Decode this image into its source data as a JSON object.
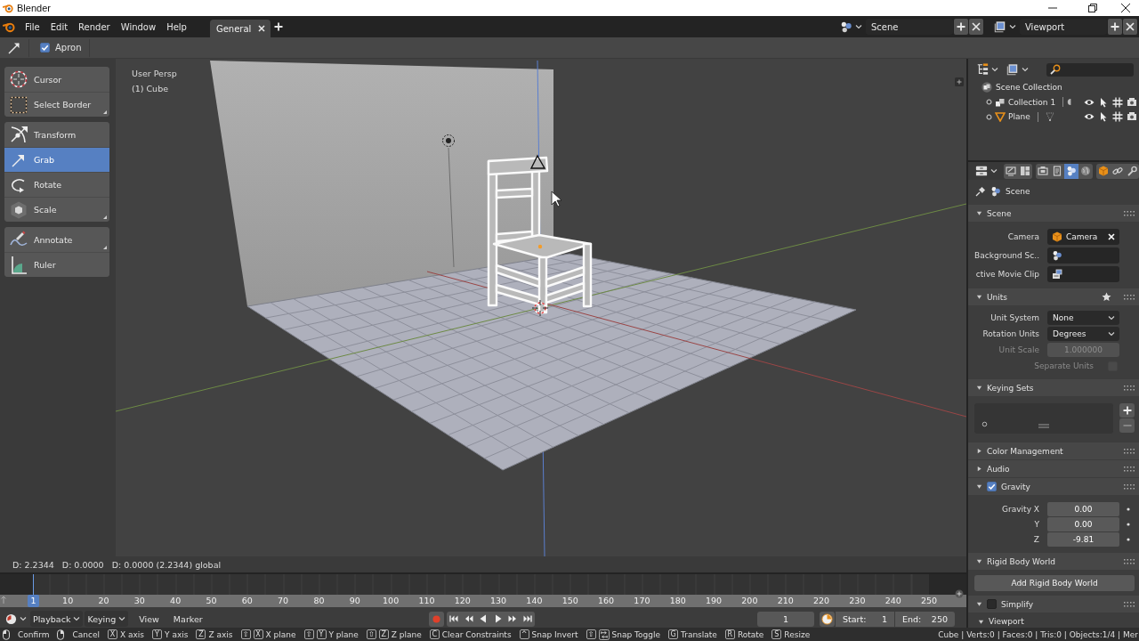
{
  "window": {
    "title": "Blender"
  },
  "menubar": {
    "menus": [
      "File",
      "Edit",
      "Render",
      "Window",
      "Help"
    ],
    "workspaces": [
      {
        "label": "General",
        "selected": true
      }
    ],
    "scene": "Scene",
    "view_layer": "Viewport"
  },
  "tool_header": {
    "options": [
      {
        "label": "Apron",
        "checked": true
      }
    ]
  },
  "toolbar": {
    "groups": [
      {
        "tools": [
          {
            "kind": "cursor",
            "label": "Cursor",
            "selected": false,
            "more": false
          },
          {
            "kind": "select_border",
            "label": "Select Border",
            "selected": false,
            "more": true
          }
        ]
      },
      {
        "tools": [
          {
            "kind": "transform",
            "label": "Transform",
            "selected": false,
            "more": false
          },
          {
            "kind": "grab",
            "label": "Grab",
            "selected": true,
            "more": false
          },
          {
            "kind": "rotate",
            "label": "Rotate",
            "selected": false,
            "more": false
          },
          {
            "kind": "scale",
            "label": "Scale",
            "selected": false,
            "more": true
          }
        ]
      },
      {
        "tools": [
          {
            "kind": "annotate",
            "label": "Annotate",
            "selected": false,
            "more": true
          },
          {
            "kind": "ruler",
            "label": "Ruler",
            "selected": false,
            "more": false
          }
        ]
      }
    ]
  },
  "viewport": {
    "view_name": "User Persp",
    "object_name": "(1) Cube",
    "header_text": "D: 2.2344   D: 0.0000   D: 0.0000 (2.2344) global"
  },
  "outliner": {
    "tree": [
      {
        "kind": "scene_collection",
        "label": "Scene Collection",
        "children": [
          {
            "kind": "collection",
            "label": "Collection 1"
          },
          {
            "kind": "mesh",
            "label": "Plane"
          }
        ]
      }
    ]
  },
  "properties": {
    "tab_groups": [
      {
        "tabs": [
          {
            "kind": "tool",
            "selected": false
          },
          {
            "kind": "workspace",
            "selected": false
          }
        ]
      },
      {
        "tabs": [
          {
            "kind": "render",
            "selected": false
          },
          {
            "kind": "output",
            "selected": false
          },
          {
            "kind": "scene",
            "selected": true
          },
          {
            "kind": "world",
            "selected": false
          }
        ]
      },
      {
        "tabs": [
          {
            "kind": "object",
            "selected": false
          },
          {
            "kind": "constraints",
            "selected": false
          },
          {
            "kind": "modifiers",
            "selected": false
          }
        ]
      }
    ],
    "breadcrumb": "Scene",
    "panels": [
      {
        "title": "Scene",
        "expanded": true,
        "rows": [
          {
            "kind": "datablock",
            "label": "Camera",
            "value": "Camera"
          },
          {
            "kind": "datablock",
            "label": "Background Sc.."
          },
          {
            "kind": "datablock",
            "label": "ctive Movie Clip"
          }
        ]
      },
      {
        "title": "Units",
        "expanded": true,
        "presets": true,
        "rows": [
          {
            "kind": "dropdown",
            "label": "Unit System",
            "value": "None",
            "disabled": false
          },
          {
            "kind": "dropdown",
            "label": "Rotation Units",
            "value": "Degrees",
            "disabled": false
          },
          {
            "kind": "number",
            "label": "Unit Scale",
            "value": "1.000000",
            "disabled": true
          },
          {
            "kind": "checkbox",
            "label": "Separate Units",
            "checked": false,
            "disabled": true
          }
        ]
      },
      {
        "title": "Keying Sets",
        "expanded": true,
        "rows": [
          {
            "kind": "list"
          }
        ]
      },
      {
        "title": "Color Management",
        "expanded": false
      },
      {
        "title": "Audio",
        "expanded": false
      },
      {
        "title": "Gravity",
        "expanded": true,
        "checked": true,
        "rows": [
          {
            "kind": "vector",
            "label": "Gravity X",
            "value": "0.00"
          },
          {
            "kind": "vector",
            "label": "Y",
            "value": "0.00"
          },
          {
            "kind": "vector",
            "label": "Z",
            "value": "-9.81"
          }
        ]
      },
      {
        "title": "Rigid Body World",
        "expanded": true,
        "rows": [
          {
            "kind": "button",
            "label": "Add Rigid Body World"
          }
        ]
      },
      {
        "title": "Simplify",
        "expanded": true,
        "checked": false,
        "rows": [
          {
            "kind": "subpanel",
            "label": "Viewport",
            "expanded": true
          }
        ]
      }
    ]
  },
  "timeline": {
    "playhead": "1",
    "ruler": [
      "10",
      "20",
      "30",
      "40",
      "50",
      "60",
      "70",
      "80",
      "90",
      "100",
      "110",
      "120",
      "130",
      "140",
      "150",
      "160",
      "170",
      "180",
      "190",
      "200",
      "210",
      "220",
      "230",
      "240",
      "250"
    ],
    "menus": [
      {
        "label": "Playback",
        "dropdown": true
      },
      {
        "label": "Keying",
        "dropdown": true
      },
      {
        "label": "View",
        "dropdown": false
      },
      {
        "label": "Marker",
        "dropdown": false
      }
    ],
    "transport": [
      {
        "kind": "jump_start"
      },
      {
        "kind": "key_prev"
      },
      {
        "kind": "play_reverse"
      },
      {
        "kind": "play"
      },
      {
        "kind": "key_next"
      },
      {
        "kind": "jump_end"
      }
    ],
    "current_frame": "1",
    "start": {
      "label": "Start:",
      "value": "1"
    },
    "end": {
      "label": "End:",
      "value": "250"
    }
  },
  "status_bar": {
    "hints": [
      {
        "keys": [
          {
            "kind": "mouse_left"
          }
        ],
        "label": "Confirm"
      },
      {
        "keys": [
          {
            "kind": "mouse_right"
          }
        ],
        "label": "Cancel"
      },
      {
        "keys": [
          {
            "kind": "key",
            "text": "X"
          }
        ],
        "label": "X axis"
      },
      {
        "keys": [
          {
            "kind": "key",
            "text": "Y"
          }
        ],
        "label": "Y axis"
      },
      {
        "keys": [
          {
            "kind": "key",
            "text": "Z"
          }
        ],
        "label": "Z axis"
      },
      {
        "keys": [
          {
            "kind": "key",
            "text": "⇧"
          },
          {
            "kind": "key",
            "text": "X"
          }
        ],
        "label": "X plane"
      },
      {
        "keys": [
          {
            "kind": "key",
            "text": "⇧"
          },
          {
            "kind": "key",
            "text": "Y"
          }
        ],
        "label": "Y plane"
      },
      {
        "keys": [
          {
            "kind": "key",
            "text": "⇧"
          },
          {
            "kind": "key",
            "text": "Z"
          }
        ],
        "label": "Z plane"
      },
      {
        "keys": [
          {
            "kind": "key",
            "text": "C"
          }
        ],
        "label": "Clear Constraints"
      },
      {
        "keys": [
          {
            "kind": "key",
            "text": "^"
          }
        ],
        "label": "Snap Invert"
      },
      {
        "keys": [
          {
            "kind": "key",
            "text": "⇧"
          },
          {
            "kind": "tab"
          }
        ],
        "label": "Snap Toggle"
      },
      {
        "keys": [
          {
            "kind": "key",
            "text": "G"
          }
        ],
        "label": "Translate"
      },
      {
        "keys": [
          {
            "kind": "key",
            "text": "R"
          }
        ],
        "label": "Rotate"
      },
      {
        "keys": [
          {
            "kind": "key",
            "text": "S"
          }
        ],
        "label": "Resize"
      }
    ],
    "stats": "Cube | Verts:0 | Faces:0 | Tris:0 | Objects:1/4 | Mer"
  }
}
